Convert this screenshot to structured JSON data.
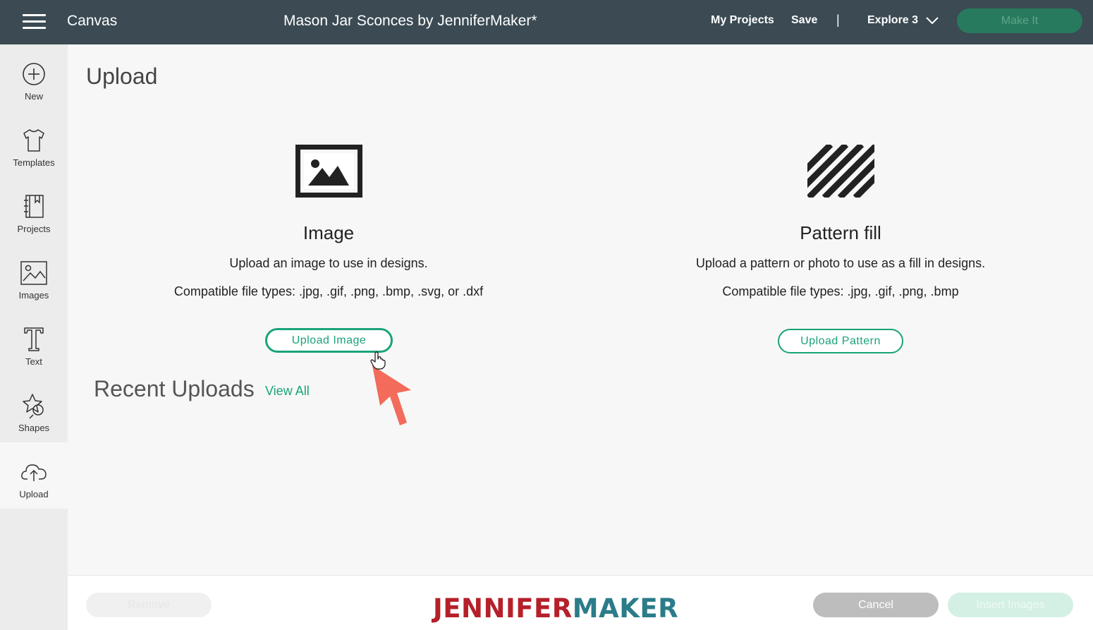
{
  "topbar": {
    "app_name": "Canvas",
    "project_title": "Mason Jar Sconces by JenniferMaker*",
    "my_projects": "My Projects",
    "save": "Save",
    "separator": "|",
    "machine": "Explore 3",
    "make_it": "Make It"
  },
  "sidebar": {
    "items": [
      {
        "label": "New",
        "icon": "plus-circle-icon"
      },
      {
        "label": "Templates",
        "icon": "tshirt-icon"
      },
      {
        "label": "Projects",
        "icon": "notebook-icon"
      },
      {
        "label": "Images",
        "icon": "image-icon"
      },
      {
        "label": "Text",
        "icon": "text-icon"
      },
      {
        "label": "Shapes",
        "icon": "shapes-icon"
      },
      {
        "label": "Upload",
        "icon": "cloud-upload-icon"
      }
    ],
    "active": "Upload"
  },
  "main": {
    "title": "Upload",
    "image": {
      "heading": "Image",
      "description": "Upload an image to use in designs.",
      "types": "Compatible file types: .jpg, .gif, .png, .bmp, .svg, or .dxf",
      "button": "Upload Image"
    },
    "pattern": {
      "heading": "Pattern fill",
      "description": "Upload a pattern or photo to use as a fill in designs.",
      "types": "Compatible file types: .jpg, .gif, .png, .bmp",
      "button": "Upload Pattern"
    },
    "recent_title": "Recent Uploads",
    "view_all": "View All"
  },
  "footer": {
    "remove": "Remove",
    "cancel": "Cancel",
    "insert": "Insert Images",
    "brand_part1": "JENNIFER",
    "brand_part2": "MAKER"
  },
  "colors": {
    "topbar": "#3b4a53",
    "accent": "#1aa37a",
    "make_it_bg": "#287a5f",
    "brand_red": "#b5202a",
    "brand_teal": "#2b7c89",
    "pointer_arrow": "#f26b5b"
  }
}
